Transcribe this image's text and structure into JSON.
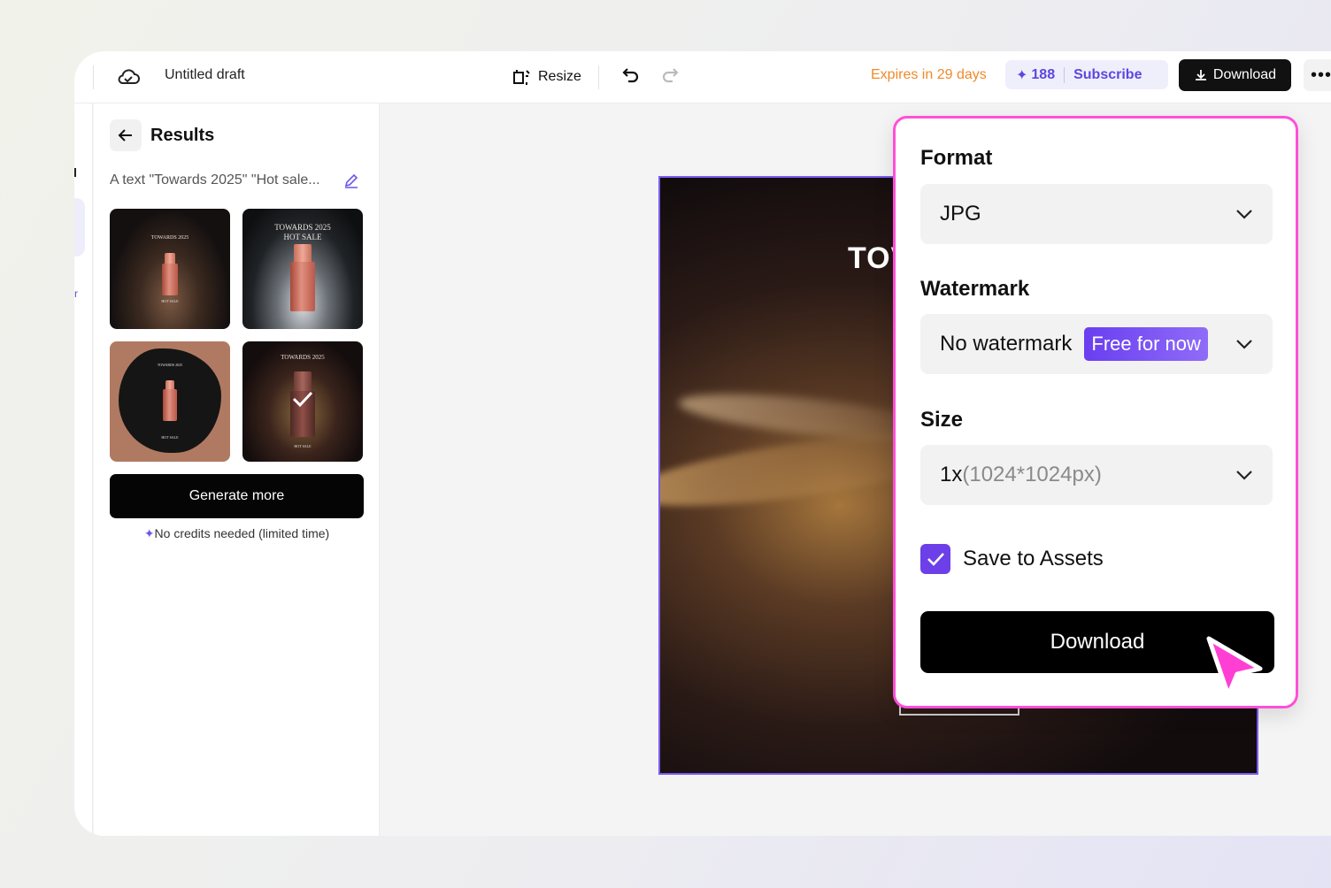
{
  "header": {
    "title": "Untitled draft",
    "resize_label": "Resize",
    "expires_text": "Expires in 29 days",
    "credits_count": "188",
    "subscribe_label": "Subscribe",
    "download_label": "Download",
    "more_label": "•••"
  },
  "sidebar": {
    "rail_marker_1": "I",
    "rail_marker_2": "r"
  },
  "results_panel": {
    "title": "Results",
    "prompt": "A text \"Towards 2025\" \"Hot sale...",
    "thumbnails": [
      {
        "caption": "TOWARDS 2025",
        "footer": "HOT SALE"
      },
      {
        "caption": "TOWARDS 2025",
        "caption2": "HOT SALE"
      },
      {
        "caption": "TOWARDS 2025",
        "footer": "HOT SALE"
      },
      {
        "caption": "TOWARDS 2025",
        "footer": "HOT SALE",
        "selected": true
      }
    ],
    "generate_label": "Generate more",
    "credits_note": "No credits needed (limited time)"
  },
  "canvas": {
    "heading_fragment": "TOV"
  },
  "download_panel": {
    "format_label": "Format",
    "format_value": "JPG",
    "watermark_label": "Watermark",
    "watermark_value": "No watermark",
    "watermark_badge": "Free for now",
    "size_label": "Size",
    "size_value": "1x",
    "size_detail": "(1024*1024px)",
    "save_to_assets_label": "Save to Assets",
    "save_to_assets_checked": true,
    "download_label": "Download"
  },
  "colors": {
    "accent": "#6c3fe8",
    "highlight_border": "#ff4fd8",
    "expires": "#f0892a",
    "credits_text": "#5a48e0"
  }
}
